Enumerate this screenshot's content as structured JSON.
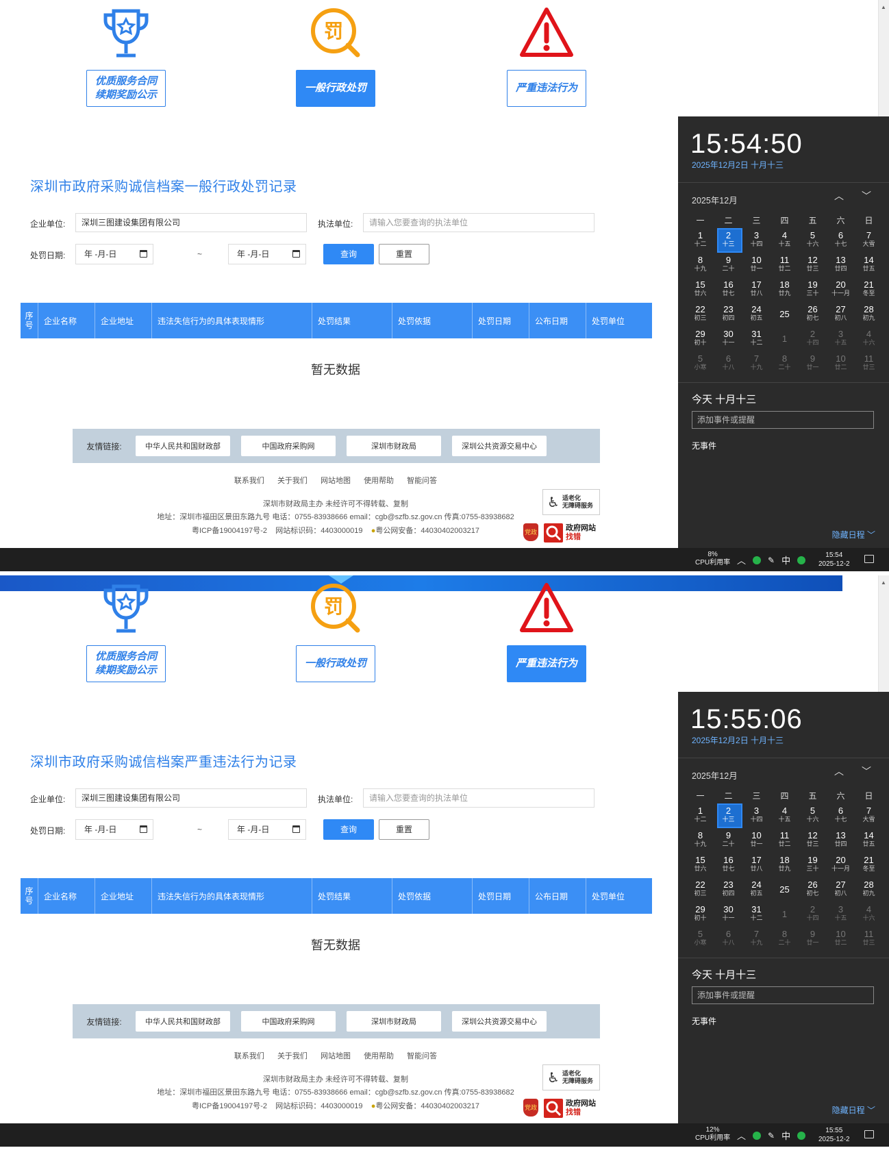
{
  "categories": [
    {
      "icon": "trophy-icon",
      "label_line1": "优质服务合同",
      "label_line2": "续期奖励公示"
    },
    {
      "icon": "penalty-icon",
      "label_line1": "一般行政处罚",
      "icon_glyph": "罚"
    },
    {
      "icon": "warning-icon",
      "label_line1": "严重违法行为"
    }
  ],
  "shots": [
    {
      "active_category": 1,
      "page_title": "深圳市政府采购诚信档案一般行政处罚记录",
      "clock": {
        "time": "15:54:50",
        "taskbar_time": "15:54",
        "cpu_percent": "8%"
      }
    },
    {
      "active_category": 2,
      "page_title": "深圳市政府采购诚信档案严重违法行为记录",
      "clock": {
        "time": "15:55:06",
        "taskbar_time": "15:55",
        "cpu_percent": "12%"
      }
    }
  ],
  "form": {
    "company_label": "企业单位:",
    "company_value": "深圳三图建设集团有限公司",
    "enforcer_label": "执法单位:",
    "enforcer_placeholder": "请输入您要查询的执法单位",
    "date_label": "处罚日期:",
    "date_placeholder": "年 -月-日",
    "date_separator": "~",
    "query_button": "查询",
    "reset_button": "重置"
  },
  "table": {
    "columns": [
      "序号",
      "企业名称",
      "企业地址",
      "违法失信行为的具体表现情形",
      "处罚结果",
      "处罚依据",
      "处罚日期",
      "公布日期",
      "处罚单位"
    ],
    "empty_text": "暂无数据"
  },
  "friend_links": {
    "label": "友情链接:",
    "items": [
      "中华人民共和国财政部",
      "中国政府采购网",
      "深圳市财政局",
      "深圳公共资源交易中心"
    ]
  },
  "footer": {
    "nav": [
      "联系我们",
      "关于我们",
      "网站地图",
      "使用帮助",
      "智能问答"
    ],
    "line1": "深圳市财政局主办 未经许可不得转载、复制",
    "line2": "地址：深圳市福田区景田东路九号 电话：0755-83938666 email：cgb@szfb.sz.gov.cn 传真:0755-83938682",
    "icp": "粤ICP备19004197号-2",
    "site_id": "网站标识码：4403000019",
    "police": "粤公网安备：44030402003217",
    "badge_elder_line1": "适老化",
    "badge_elder_line2": "无障碍服务",
    "emblem_text": "党政",
    "badge_error_line1": "政府网站",
    "badge_error_line2": "找错"
  },
  "calendar_panel": {
    "date_line": "2025年12月2日 十月十三",
    "month": "2025年12月",
    "weekdays": [
      "一",
      "二",
      "三",
      "四",
      "五",
      "六",
      "日"
    ],
    "days": [
      {
        "n": "1",
        "l": "十二"
      },
      {
        "n": "2",
        "l": "十三",
        "sel": true
      },
      {
        "n": "3",
        "l": "十四"
      },
      {
        "n": "4",
        "l": "十五"
      },
      {
        "n": "5",
        "l": "十六"
      },
      {
        "n": "6",
        "l": "十七"
      },
      {
        "n": "7",
        "l": "大雪"
      },
      {
        "n": "8",
        "l": "十九"
      },
      {
        "n": "9",
        "l": "二十"
      },
      {
        "n": "10",
        "l": "廿一"
      },
      {
        "n": "11",
        "l": "廿二"
      },
      {
        "n": "12",
        "l": "廿三"
      },
      {
        "n": "13",
        "l": "廿四"
      },
      {
        "n": "14",
        "l": "廿五"
      },
      {
        "n": "15",
        "l": "廿六"
      },
      {
        "n": "16",
        "l": "廿七"
      },
      {
        "n": "17",
        "l": "廿八"
      },
      {
        "n": "18",
        "l": "廿九"
      },
      {
        "n": "19",
        "l": "三十"
      },
      {
        "n": "20",
        "l": "十一月"
      },
      {
        "n": "21",
        "l": "冬至"
      },
      {
        "n": "22",
        "l": "初三"
      },
      {
        "n": "23",
        "l": "初四"
      },
      {
        "n": "24",
        "l": "初五"
      },
      {
        "n": "25",
        "l": ""
      },
      {
        "n": "26",
        "l": "初七"
      },
      {
        "n": "27",
        "l": "初八"
      },
      {
        "n": "28",
        "l": "初九"
      },
      {
        "n": "29",
        "l": "初十"
      },
      {
        "n": "30",
        "l": "十一"
      },
      {
        "n": "31",
        "l": "十二"
      },
      {
        "n": "1",
        "l": "",
        "dim": true
      },
      {
        "n": "2",
        "l": "十四",
        "dim": true
      },
      {
        "n": "3",
        "l": "十五",
        "dim": true
      },
      {
        "n": "4",
        "l": "十六",
        "dim": true
      },
      {
        "n": "5",
        "l": "小寒",
        "dim": true
      },
      {
        "n": "6",
        "l": "十八",
        "dim": true
      },
      {
        "n": "7",
        "l": "十九",
        "dim": true
      },
      {
        "n": "8",
        "l": "二十",
        "dim": true
      },
      {
        "n": "9",
        "l": "廿一",
        "dim": true
      },
      {
        "n": "10",
        "l": "廿二",
        "dim": true
      },
      {
        "n": "11",
        "l": "廿三",
        "dim": true
      }
    ],
    "today_label": "今天 十月十三",
    "event_placeholder": "添加事件或提醒",
    "no_events": "无事件",
    "hide_schedule": "隐藏日程 ﹀"
  },
  "taskbar": {
    "cpu_label": "CPU利用率",
    "ime": "中",
    "date": "2025-12-2"
  },
  "colors": {
    "accent": "#2f89f5",
    "title_blue": "#2f80e8",
    "warning_red": "#e0141a",
    "penalty_orange": "#f5a012",
    "panel_bg": "#2b2b2b"
  }
}
